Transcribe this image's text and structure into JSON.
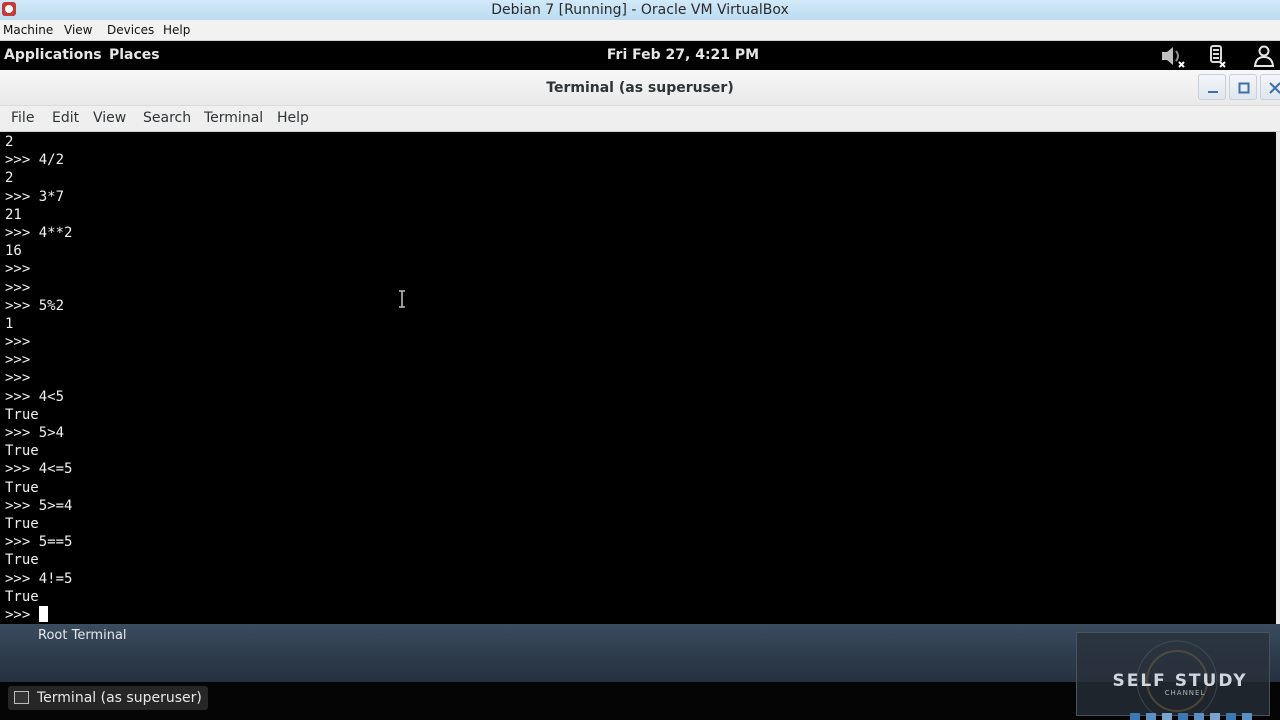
{
  "vbox": {
    "title": "Debian 7 [Running] - Oracle VM VirtualBox",
    "menu": [
      "Machine",
      "View",
      "Devices",
      "Help"
    ]
  },
  "gnome_panel": {
    "applications": "Applications",
    "places": "Places",
    "clock": "Fri Feb 27,  4:21 PM",
    "icons": [
      "volume-muted-icon",
      "network-icon",
      "user-icon"
    ]
  },
  "terminal": {
    "title": "Terminal (as superuser)",
    "menu": [
      "File",
      "Edit",
      "View",
      "Search",
      "Terminal",
      "Help"
    ],
    "lines": [
      "2",
      ">>> 4/2",
      "2",
      ">>> 3*7",
      "21",
      ">>> 4**2",
      "16",
      ">>>",
      ">>>",
      ">>> 5%2",
      "1",
      ">>>",
      ">>>",
      ">>>",
      ">>> 4<5",
      "True",
      ">>> 5>4",
      "True",
      ">>> 4<=5",
      "True",
      ">>> 5>=4",
      "True",
      ">>> 5==5",
      "True",
      ">>> 4!=5",
      "True"
    ],
    "prompt": ">>> "
  },
  "desktop": {
    "root_terminal_label": "Root Terminal"
  },
  "taskbar": {
    "item": "Terminal (as superuser)"
  },
  "watermark": {
    "title": "SELF STUDY",
    "subtitle": "CHANNEL"
  }
}
